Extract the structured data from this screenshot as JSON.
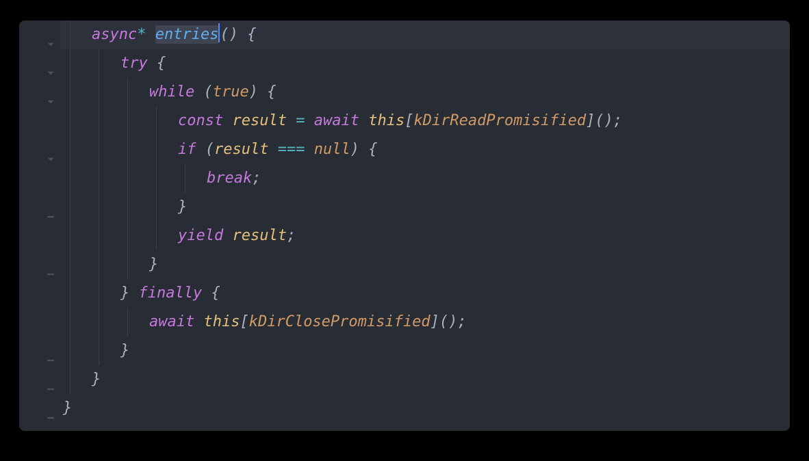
{
  "editor": {
    "theme": "one-dark",
    "highlighted_line_index": 0,
    "selection_word": "entries",
    "cursor_after_selection": true
  },
  "code": {
    "lines": [
      {
        "indent": 1,
        "fold": "open",
        "tokens": [
          {
            "t": "async",
            "c": "keyword"
          },
          {
            "t": "* ",
            "c": "star"
          },
          {
            "t": "entries",
            "c": "func",
            "sel": true
          },
          {
            "t": "()",
            "c": "punc"
          },
          {
            "t": " ",
            "c": "default"
          },
          {
            "t": "{",
            "c": "brace"
          }
        ]
      },
      {
        "indent": 2,
        "fold": "open",
        "tokens": [
          {
            "t": "try",
            "c": "keyword"
          },
          {
            "t": " ",
            "c": "default"
          },
          {
            "t": "{",
            "c": "brace"
          }
        ]
      },
      {
        "indent": 3,
        "fold": "open",
        "tokens": [
          {
            "t": "while",
            "c": "keyword"
          },
          {
            "t": " (",
            "c": "punc"
          },
          {
            "t": "true",
            "c": "const"
          },
          {
            "t": ") ",
            "c": "punc"
          },
          {
            "t": "{",
            "c": "brace"
          }
        ]
      },
      {
        "indent": 4,
        "fold": null,
        "tokens": [
          {
            "t": "const",
            "c": "storage"
          },
          {
            "t": " ",
            "c": "default"
          },
          {
            "t": "result",
            "c": "var"
          },
          {
            "t": " ",
            "c": "default"
          },
          {
            "t": "=",
            "c": "op"
          },
          {
            "t": " ",
            "c": "default"
          },
          {
            "t": "await",
            "c": "keyword"
          },
          {
            "t": " ",
            "c": "default"
          },
          {
            "t": "this",
            "c": "this"
          },
          {
            "t": "[",
            "c": "punc"
          },
          {
            "t": "kDirReadPromisified",
            "c": "prop"
          },
          {
            "t": "]();",
            "c": "punc"
          }
        ]
      },
      {
        "indent": 4,
        "fold": "open",
        "tokens": [
          {
            "t": "if",
            "c": "keyword"
          },
          {
            "t": " (",
            "c": "punc"
          },
          {
            "t": "result",
            "c": "var"
          },
          {
            "t": " ",
            "c": "default"
          },
          {
            "t": "===",
            "c": "op"
          },
          {
            "t": " ",
            "c": "default"
          },
          {
            "t": "null",
            "c": "null"
          },
          {
            "t": ") ",
            "c": "punc"
          },
          {
            "t": "{",
            "c": "brace"
          }
        ]
      },
      {
        "indent": 5,
        "fold": null,
        "tokens": [
          {
            "t": "break",
            "c": "keyword"
          },
          {
            "t": ";",
            "c": "punc"
          }
        ]
      },
      {
        "indent": 4,
        "fold": "close",
        "tokens": [
          {
            "t": "}",
            "c": "brace"
          }
        ]
      },
      {
        "indent": 4,
        "fold": null,
        "tokens": [
          {
            "t": "yield",
            "c": "keyword"
          },
          {
            "t": " ",
            "c": "default"
          },
          {
            "t": "result",
            "c": "var"
          },
          {
            "t": ";",
            "c": "punc"
          }
        ]
      },
      {
        "indent": 3,
        "fold": "close",
        "tokens": [
          {
            "t": "}",
            "c": "brace"
          }
        ]
      },
      {
        "indent": 2,
        "fold": null,
        "tokens": [
          {
            "t": "}",
            "c": "brace"
          },
          {
            "t": " ",
            "c": "default"
          },
          {
            "t": "finally",
            "c": "keyword"
          },
          {
            "t": " ",
            "c": "default"
          },
          {
            "t": "{",
            "c": "brace"
          }
        ]
      },
      {
        "indent": 3,
        "fold": null,
        "tokens": [
          {
            "t": "await",
            "c": "keyword"
          },
          {
            "t": " ",
            "c": "default"
          },
          {
            "t": "this",
            "c": "this"
          },
          {
            "t": "[",
            "c": "punc"
          },
          {
            "t": "kDirClosePromisified",
            "c": "prop"
          },
          {
            "t": "]();",
            "c": "punc"
          }
        ]
      },
      {
        "indent": 2,
        "fold": "close",
        "tokens": [
          {
            "t": "}",
            "c": "brace"
          }
        ]
      },
      {
        "indent": 1,
        "fold": "close",
        "tokens": [
          {
            "t": "}",
            "c": "brace"
          }
        ]
      },
      {
        "indent": 0,
        "fold": "close",
        "tokens": [
          {
            "t": "}",
            "c": "brace"
          }
        ]
      }
    ]
  }
}
